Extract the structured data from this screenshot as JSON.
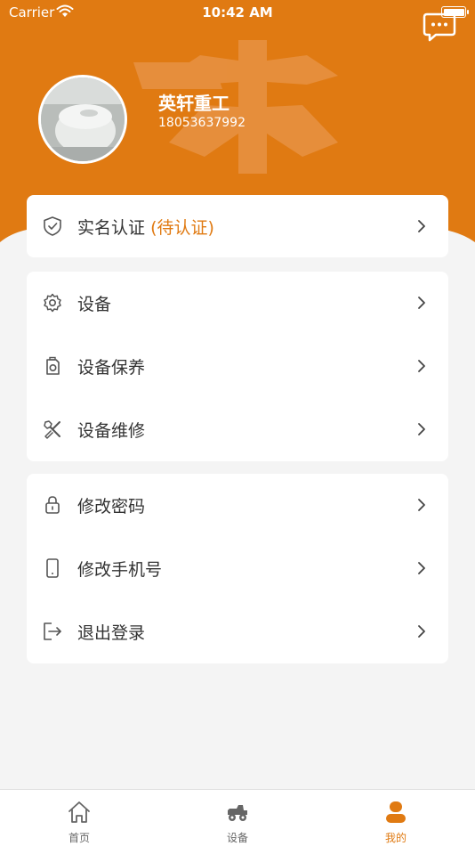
{
  "status_bar": {
    "carrier": "Carrier",
    "time": "10:42 AM"
  },
  "colors": {
    "brand": "#e07a12",
    "pending": "#e07a12",
    "bg": "#f4f4f4"
  },
  "profile": {
    "name": "英轩重工",
    "phone": "18053637992"
  },
  "auth": {
    "label": "实名认证",
    "status": "(待认证)"
  },
  "device_menu": [
    {
      "label": "设备",
      "icon": "gear-icon"
    },
    {
      "label": "设备保养",
      "icon": "maintenance-icon"
    },
    {
      "label": "设备维修",
      "icon": "repair-tools-icon"
    }
  ],
  "account_menu": [
    {
      "label": "修改密码",
      "icon": "lock-icon"
    },
    {
      "label": "修改手机号",
      "icon": "phone-icon"
    },
    {
      "label": "退出登录",
      "icon": "logout-icon"
    }
  ],
  "tabbar": [
    {
      "label": "首页",
      "icon": "home-icon",
      "active": false
    },
    {
      "label": "设备",
      "icon": "machine-icon",
      "active": false
    },
    {
      "label": "我的",
      "icon": "user-icon",
      "active": true
    }
  ]
}
